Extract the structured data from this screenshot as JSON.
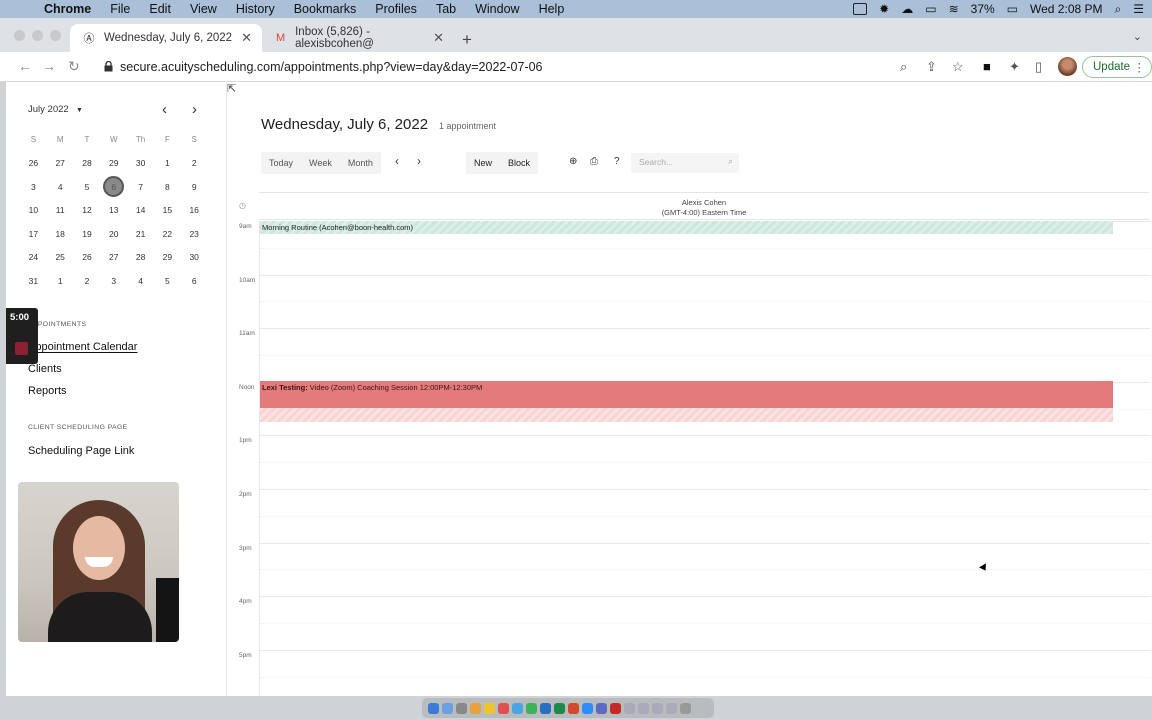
{
  "menubar": {
    "app": "Chrome",
    "items": [
      "File",
      "Edit",
      "View",
      "History",
      "Bookmarks",
      "Profiles",
      "Tab",
      "Window",
      "Help"
    ],
    "battery": "37%",
    "clock": "Wed 2:08 PM"
  },
  "tabs": [
    {
      "title": "Wednesday, July 6, 2022",
      "active": true
    },
    {
      "title": "Inbox (5,826) - alexisbcohen@",
      "active": false
    }
  ],
  "toolbar": {
    "url": "secure.acuityscheduling.com/appointments.php?view=day&day=2022-07-06",
    "update_label": "Update"
  },
  "mini_calendar": {
    "month_label": "July 2022",
    "weekday_headers": [
      "S",
      "M",
      "T",
      "W",
      "Th",
      "F",
      "S"
    ],
    "weeks": [
      [
        "26",
        "27",
        "28",
        "29",
        "30",
        "1",
        "2"
      ],
      [
        "3",
        "4",
        "5",
        "6",
        "7",
        "8",
        "9"
      ],
      [
        "10",
        "11",
        "12",
        "13",
        "14",
        "15",
        "16"
      ],
      [
        "17",
        "18",
        "19",
        "20",
        "21",
        "22",
        "23"
      ],
      [
        "24",
        "25",
        "26",
        "27",
        "28",
        "29",
        "30"
      ],
      [
        "31",
        "1",
        "2",
        "3",
        "4",
        "5",
        "6"
      ]
    ],
    "selected": "6"
  },
  "sidebar": {
    "appointments_heading": "APPOINTMENTS",
    "links": [
      "Appointment Calendar",
      "Clients",
      "Reports"
    ],
    "client_heading": "CLIENT SCHEDULING PAGE",
    "scheduling_link": "Scheduling Page Link"
  },
  "recording": {
    "timer": "5:00"
  },
  "main": {
    "title": "Wednesday, July 6, 2022",
    "appointment_count": "1 appointment",
    "view_buttons": [
      "Today",
      "Week",
      "Month"
    ],
    "action_buttons": [
      "New",
      "Block"
    ],
    "help_icon_label": "?",
    "search_placeholder": "Search...",
    "column_name": "Alexis Cohen",
    "column_tz": "(GMT-4:00) Eastern Time",
    "hours": [
      "9am",
      "10am",
      "11am",
      "Noon",
      "1pm",
      "2pm",
      "3pm",
      "4pm",
      "5pm"
    ],
    "events": {
      "morning": "Morning Routine (Acohen@boon-health.com)",
      "lexi_name": "Lexi Testing:",
      "lexi_detail": "Video (Zoom) Coaching Session   12:00PM-12:30PM"
    }
  },
  "colors": {
    "morning_event": "#d5ebe0",
    "lexi_event": "#e57a7c",
    "update_green": "#1e6b2c"
  }
}
